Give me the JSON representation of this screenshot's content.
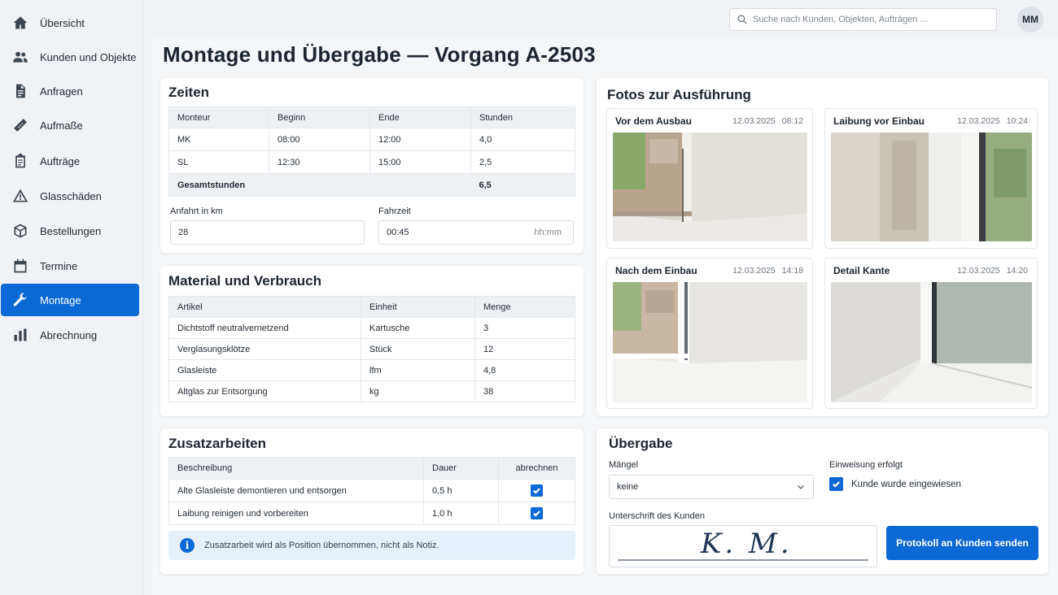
{
  "sidebar": {
    "items": [
      {
        "label": "Übersicht",
        "icon": "home-icon"
      },
      {
        "label": "Kunden und Objekte",
        "icon": "people-icon"
      },
      {
        "label": "Anfragen",
        "icon": "document-icon"
      },
      {
        "label": "Aufmaße",
        "icon": "ruler-icon"
      },
      {
        "label": "Aufträge",
        "icon": "clipboard-icon"
      },
      {
        "label": "Glasschäden",
        "icon": "warning-icon"
      },
      {
        "label": "Bestellungen",
        "icon": "package-icon"
      },
      {
        "label": "Termine",
        "icon": "calendar-icon"
      },
      {
        "label": "Montage",
        "icon": "wrench-icon",
        "active": true
      },
      {
        "label": "Abrechnung",
        "icon": "bar-chart-icon"
      }
    ]
  },
  "header": {
    "search_placeholder": "Suche nach Kunden, Objekten, Aufträgen ...",
    "avatar_initials": "MM"
  },
  "page": {
    "title": "Montage und Übergabe — Vorgang A-2503"
  },
  "zeiten": {
    "title": "Zeiten",
    "columns": [
      "Monteur",
      "Beginn",
      "Ende",
      "Stunden"
    ],
    "rows": [
      [
        "MK",
        "08:00",
        "12:00",
        "4,0"
      ],
      [
        "SL",
        "12:30",
        "15:00",
        "2,5"
      ]
    ],
    "total_label": "Gesamtstunden",
    "total_value": "6,5",
    "anfahrt_label": "Anfahrt in km",
    "anfahrt_value": "28",
    "fahrzeit_label": "Fahrzeit",
    "fahrzeit_value": "00:45",
    "fahrzeit_hint": "hh:mm"
  },
  "material": {
    "title": "Material und Verbrauch",
    "columns": [
      "Artikel",
      "Einheit",
      "Menge"
    ],
    "rows": [
      [
        "Dichtstoff neutralvernetzend",
        "Kartusche",
        "3"
      ],
      [
        "Verglasungsklötze",
        "Stück",
        "12"
      ],
      [
        "Glasleiste",
        "lfm",
        "4,8"
      ],
      [
        "Altglas zur Entsorgung",
        "kg",
        "38"
      ]
    ]
  },
  "zusatz": {
    "title": "Zusatzarbeiten",
    "columns": [
      "Beschreibung",
      "Dauer",
      "abrechnen"
    ],
    "rows": [
      {
        "beschreibung": "Alte Glasleiste demontieren und entsorgen",
        "dauer": "0,5 h",
        "abrechnen": true
      },
      {
        "beschreibung": "Laibung reinigen und vorbereiten",
        "dauer": "1,0 h",
        "abrechnen": true
      }
    ],
    "info": "Zusatzarbeit wird als Position übernommen, nicht als Notiz."
  },
  "fotos": {
    "title": "Fotos zur Ausführung",
    "items": [
      {
        "title": "Vor dem Ausbau",
        "date": "12.03.2025",
        "time": "08:12"
      },
      {
        "title": "Laibung vor Einbau",
        "date": "12.03.2025",
        "time": "10:24"
      },
      {
        "title": "Nach dem Einbau",
        "date": "12.03.2025",
        "time": "14:18"
      },
      {
        "title": "Detail Kante",
        "date": "12.03.2025",
        "time": "14:20"
      }
    ]
  },
  "uebergabe": {
    "title": "Übergabe",
    "maengel_label": "Mängel",
    "maengel_value": "keine",
    "einweisung_label": "Einweisung erfolgt",
    "einweisung_checkbox_label": "Kunde wurde eingewiesen",
    "einweisung_checked": true,
    "signature_label": "Unterschrift des Kunden",
    "signature_text": "K. M.",
    "send_button": "Protokoll an Kunden senden"
  },
  "colors": {
    "accent": "#0b69d6",
    "background": "#f0f2f5",
    "table_header": "#eef1f4"
  }
}
